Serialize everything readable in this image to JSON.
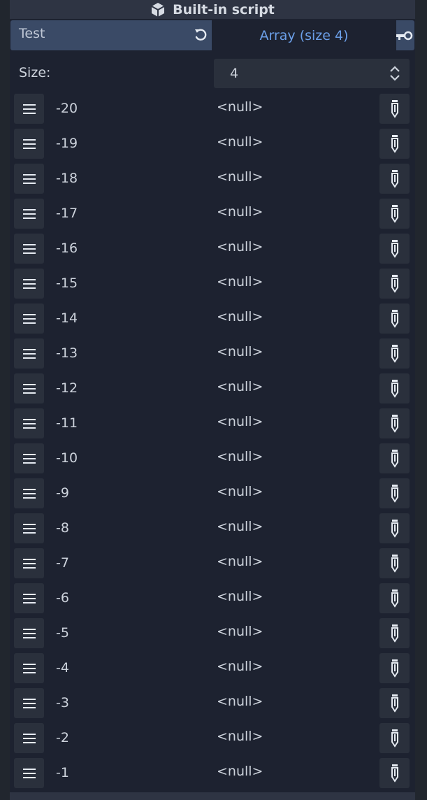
{
  "header": {
    "title": "Built-in script",
    "icon": "cube-icon"
  },
  "property": {
    "name": "Test",
    "value_label": "Array (size 4)",
    "accent": "#6b9fe8"
  },
  "size": {
    "label": "Size:",
    "value": "4"
  },
  "items": [
    {
      "index": "-20",
      "value": "<null>"
    },
    {
      "index": "-19",
      "value": "<null>"
    },
    {
      "index": "-18",
      "value": "<null>"
    },
    {
      "index": "-17",
      "value": "<null>"
    },
    {
      "index": "-16",
      "value": "<null>"
    },
    {
      "index": "-15",
      "value": "<null>"
    },
    {
      "index": "-14",
      "value": "<null>"
    },
    {
      "index": "-13",
      "value": "<null>"
    },
    {
      "index": "-12",
      "value": "<null>"
    },
    {
      "index": "-11",
      "value": "<null>"
    },
    {
      "index": "-10",
      "value": "<null>"
    },
    {
      "index": "-9",
      "value": "<null>"
    },
    {
      "index": "-8",
      "value": "<null>"
    },
    {
      "index": "-7",
      "value": "<null>"
    },
    {
      "index": "-6",
      "value": "<null>"
    },
    {
      "index": "-5",
      "value": "<null>"
    },
    {
      "index": "-4",
      "value": "<null>"
    },
    {
      "index": "-3",
      "value": "<null>"
    },
    {
      "index": "-2",
      "value": "<null>"
    },
    {
      "index": "-1",
      "value": "<null>"
    }
  ]
}
